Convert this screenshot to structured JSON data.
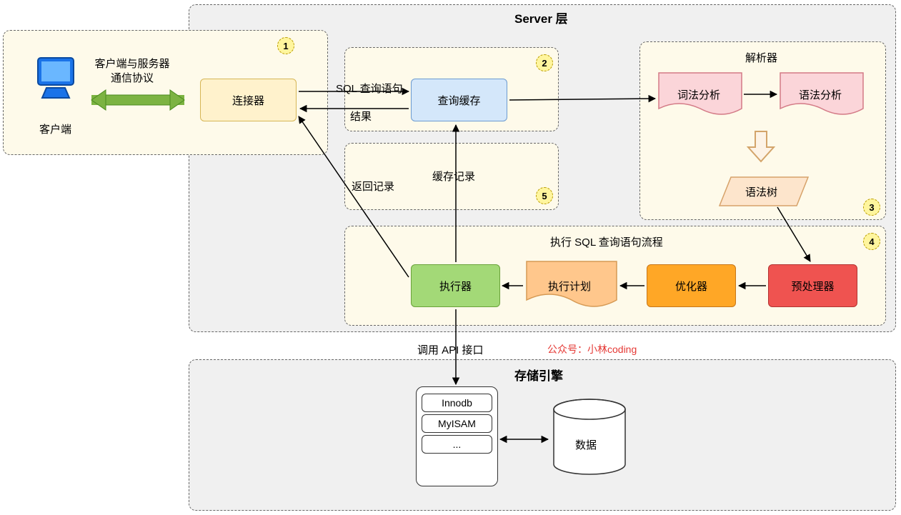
{
  "titles": {
    "server_layer": "Server 层",
    "storage_engine": "存储引擎",
    "parser": "解析器",
    "exec_flow": "执行 SQL 查询语句流程"
  },
  "nodes": {
    "client": "客户端",
    "connector": "连接器",
    "query_cache": "查询缓存",
    "lexical": "词法分析",
    "syntax": "语法分析",
    "syntax_tree": "语法树",
    "preprocessor": "预处理器",
    "optimizer": "优化器",
    "exec_plan": "执行计划",
    "executor": "执行器",
    "data": "数据"
  },
  "edges": {
    "client_server": "客户端与服务器\n通信协议",
    "sql_query": "SQL 查询语句",
    "result": "结果",
    "cache_record": "缓存记录",
    "return_record": "返回记录",
    "call_api": "调用 API 接口"
  },
  "engines": {
    "innodb": "Innodb",
    "myisam": "MyISAM",
    "more": "..."
  },
  "badges": {
    "b1": "1",
    "b2": "2",
    "b3": "3",
    "b4": "4",
    "b5": "5"
  },
  "watermark": "公众号：小林coding"
}
